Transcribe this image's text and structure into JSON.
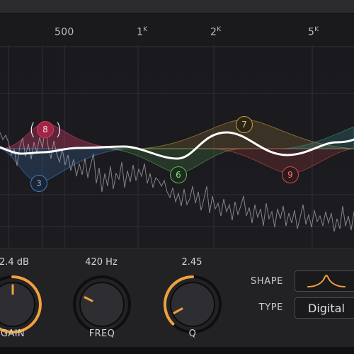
{
  "colors": {
    "accent": "#f0a03c",
    "background": "#1c1c1f",
    "band3": "#3f7fc4",
    "band6": "#5fb85a",
    "band7": "#c9a040",
    "band8": "#d03c68",
    "band9": "#d94a4a",
    "eq_curve": "#ffffff"
  },
  "frequency_axis": {
    "labels": [
      {
        "text": "500",
        "suffix": ""
      },
      {
        "text": "1",
        "suffix": "K"
      },
      {
        "text": "2",
        "suffix": "K"
      },
      {
        "text": "5",
        "suffix": "K"
      }
    ]
  },
  "bands": [
    {
      "label": "8",
      "color_key": "band8",
      "selected": true
    },
    {
      "label": "7",
      "color_key": "band7",
      "selected": false
    },
    {
      "label": "3",
      "color_key": "band3",
      "selected": false
    },
    {
      "label": "6",
      "color_key": "band6",
      "selected": false
    },
    {
      "label": "9",
      "color_key": "band9",
      "selected": false
    }
  ],
  "controls": {
    "gain": {
      "label": "GAIN",
      "value_text": "2.4 dB",
      "value": 2.4,
      "unit": "dB"
    },
    "freq": {
      "label": "FREQ",
      "value_text": "420 Hz",
      "value": 420,
      "unit": "Hz"
    },
    "q": {
      "label": "Q",
      "value_text": "2.45",
      "value": 2.45
    }
  },
  "shape": {
    "label": "SHAPE",
    "icon": "bell-curve-icon"
  },
  "type": {
    "label": "TYPE",
    "value": "Digital"
  }
}
